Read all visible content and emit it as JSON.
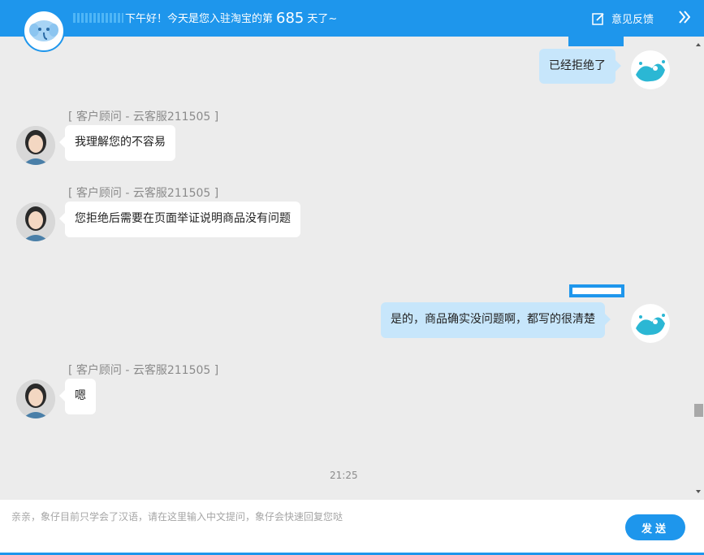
{
  "header": {
    "greeting": "下午好！今天是您入驻淘宝的第",
    "days": "685",
    "days_suffix": "天了~",
    "feedback_label": "意见反馈"
  },
  "messages": [
    {
      "role": "user",
      "text": "已经拒绝了"
    },
    {
      "role": "agent",
      "sender": "[ 客户顾问  -  云客服211505 ]",
      "text": "我理解您的不容易"
    },
    {
      "role": "agent",
      "sender": "[ 客户顾问  -  云客服211505 ]",
      "text": "您拒绝后需要在页面举证说明商品没有问题"
    },
    {
      "role": "user",
      "text": "是的，商品确实没问题啊，都写的很清楚"
    },
    {
      "role": "agent",
      "sender": "[ 客户顾问  -  云客服211505 ]",
      "text": "嗯"
    }
  ],
  "timestamp": "21:25",
  "input": {
    "placeholder": "亲亲，象仔目前只学会了汉语，请在这里输入中文提问，象仔会快速回复您哒",
    "value": ""
  },
  "send_label": "发送",
  "colors": {
    "accent": "#1e96ec",
    "user_bubble": "#c7e6fb",
    "agent_bubble": "#ffffff",
    "chat_background": "#ececec"
  },
  "icons": {
    "logo": "elephant-logo-icon",
    "feedback": "edit-icon",
    "collapse": "double-chevron-right-icon"
  }
}
